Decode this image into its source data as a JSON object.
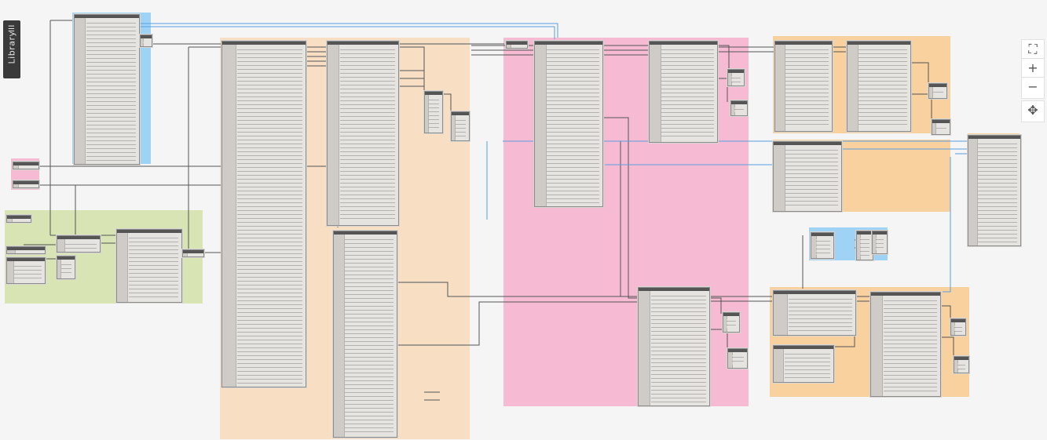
{
  "app": {
    "library_tab_label": "Library",
    "library_tab_icon": "filter-icon"
  },
  "colors": {
    "canvas": "#f5f5f5",
    "group_blue": "#9fd3f5",
    "group_pink": "#f7bad3",
    "group_green": "#d8e4b3",
    "group_peach": "#f8dfc4",
    "group_orange": "#f8d19f",
    "node_body": "#e6e4e1",
    "node_header": "#555555",
    "wire_dark": "#555555",
    "wire_blue": "#5aa0e0"
  },
  "navigation": {
    "zoom_fit_icon": "zoom-to-fit-icon",
    "zoom_in_label": "+",
    "zoom_out_label": "−",
    "pan_icon": "pan-icon"
  }
}
